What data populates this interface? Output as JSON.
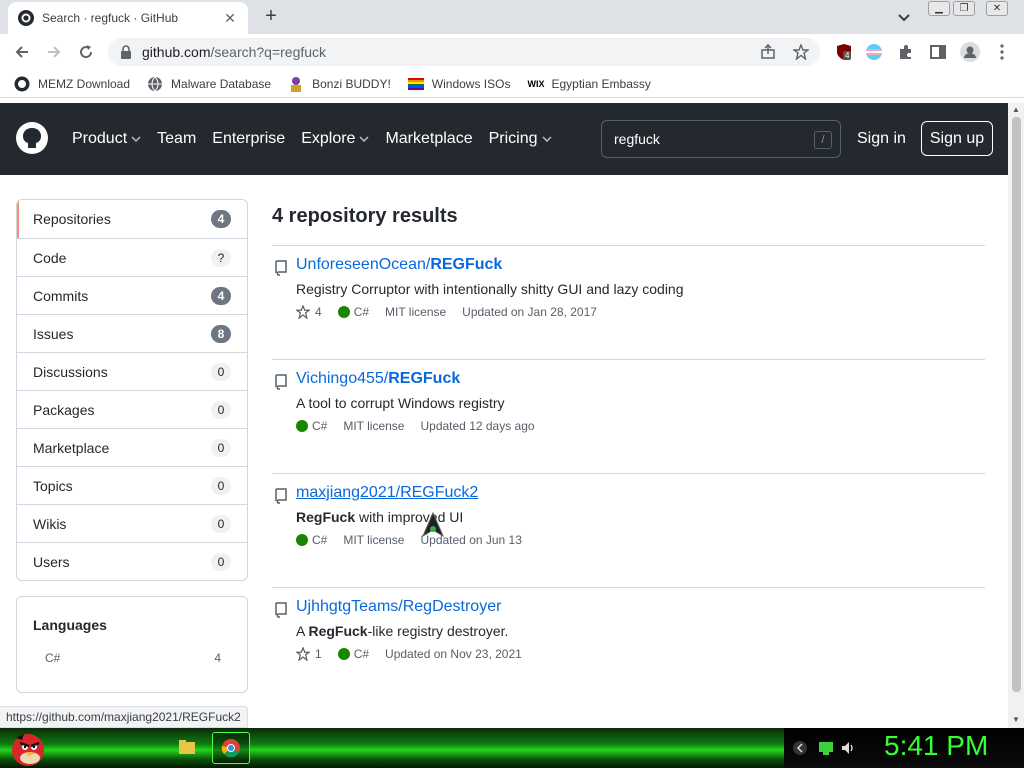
{
  "browser": {
    "tab_title": "Search · regfuck · GitHub",
    "tab_close": "✕",
    "new_tab": "+",
    "url_host": "github.com",
    "url_path": "/search?q=regfuck",
    "extension_badge": "4",
    "bookmarks": [
      {
        "label": "MEMZ Download",
        "icon": "github-icon"
      },
      {
        "label": "Malware Database",
        "icon": "globe-icon"
      },
      {
        "label": "Bonzi BUDDY!",
        "icon": "bonzi-icon"
      },
      {
        "label": "Windows ISOs",
        "icon": "rainbow-flag-icon"
      },
      {
        "label": "Egyptian Embassy",
        "icon": "wix-icon"
      }
    ],
    "status_url": "https://github.com/maxjiang2021/REGFuck2"
  },
  "header": {
    "nav": [
      {
        "label": "Product",
        "dropdown": true
      },
      {
        "label": "Team",
        "dropdown": false
      },
      {
        "label": "Enterprise",
        "dropdown": false
      },
      {
        "label": "Explore",
        "dropdown": true
      },
      {
        "label": "Marketplace",
        "dropdown": false
      },
      {
        "label": "Pricing",
        "dropdown": true
      }
    ],
    "search_value": "regfuck",
    "search_shortcut": "/",
    "sign_in": "Sign in",
    "sign_up": "Sign up"
  },
  "sidebar": {
    "items": [
      {
        "label": "Repositories",
        "count": "4",
        "selected": true
      },
      {
        "label": "Code",
        "count": "?"
      },
      {
        "label": "Commits",
        "count": "4"
      },
      {
        "label": "Issues",
        "count": "8"
      },
      {
        "label": "Discussions",
        "count": "0"
      },
      {
        "label": "Packages",
        "count": "0"
      },
      {
        "label": "Marketplace",
        "count": "0"
      },
      {
        "label": "Topics",
        "count": "0"
      },
      {
        "label": "Wikis",
        "count": "0"
      },
      {
        "label": "Users",
        "count": "0"
      }
    ],
    "languages_title": "Languages",
    "languages": [
      {
        "name": "C#",
        "count": "4"
      }
    ]
  },
  "results": {
    "title": "4 repository results",
    "items": [
      {
        "owner": "UnforeseenOcean/",
        "name": "REGFuck",
        "desc_pre": "Registry Corruptor with intentionally shitty GUI and lazy coding",
        "desc_bold": "",
        "desc_post": "",
        "stars": "4",
        "language": "C#",
        "license": "MIT license",
        "updated": "Updated on Jan 28, 2017"
      },
      {
        "owner": "Vichingo455/",
        "name": "REGFuck",
        "desc_pre": "A tool to corrupt Windows registry",
        "desc_bold": "",
        "desc_post": "",
        "stars": "",
        "language": "C#",
        "license": "MIT license",
        "updated": "Updated 12 days ago"
      },
      {
        "owner": "maxjiang2021/",
        "name": "REGFuck2",
        "desc_pre": "",
        "desc_bold": "RegFuck",
        "desc_post": " with improved UI",
        "stars": "",
        "language": "C#",
        "license": "MIT license",
        "updated": "Updated on Jun 13"
      },
      {
        "owner": "UjhhgtgTeams/",
        "name": "RegDestroyer",
        "desc_pre": "A ",
        "desc_bold": "RegFuck",
        "desc_post": "-like registry destroyer.",
        "stars": "1",
        "language": "C#",
        "license": "",
        "updated": "Updated on Nov 23, 2021"
      }
    ]
  },
  "taskbar": {
    "clock": "5:41 PM"
  },
  "colors": {
    "header_bg": "#24292f",
    "link": "#0969da",
    "csharp": "#178600",
    "selected_accent": "#fd8c73",
    "clock": "#37ff37"
  }
}
